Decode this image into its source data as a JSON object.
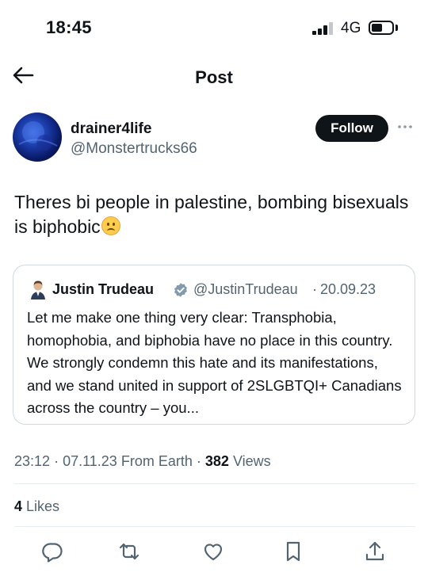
{
  "status_bar": {
    "time": "18:45",
    "network": "4G"
  },
  "header": {
    "title": "Post"
  },
  "author": {
    "name": "drainer4life",
    "handle": "@Monstertrucks66",
    "follow_label": "Follow"
  },
  "tweet": {
    "text": "Theres bi people in palestine, bombing bisexuals is biphobic",
    "emoji": "confused-face"
  },
  "quote": {
    "name": "Justin Trudeau",
    "handle": "@JustinTrudeau",
    "separator": "·",
    "date": "20.09.23",
    "text": "Let me make one thing very clear: Transphobia, homophobia, and biphobia have no place in this country. We strongly condemn this hate and its manifestations, and we stand united in support of 2SLGBTQI+ Canadians across the country – you..."
  },
  "meta": {
    "time": "23:12",
    "date": "07.11.23",
    "source": "From Earth",
    "views_count": "382",
    "views_label": "Views",
    "sep": "·"
  },
  "engagement": {
    "likes_count": "4",
    "likes_label": "Likes"
  },
  "actions": [
    "reply-icon",
    "repost-icon",
    "like-icon",
    "bookmark-icon",
    "share-icon"
  ],
  "colors": {
    "text": "#0f1419",
    "secondary": "#536471",
    "border": "#cfd9de",
    "verified": "#829aab"
  }
}
